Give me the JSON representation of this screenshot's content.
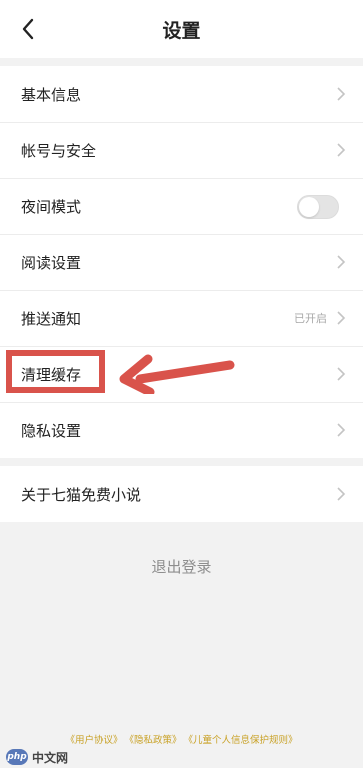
{
  "header": {
    "title": "设置"
  },
  "settings": {
    "items": [
      {
        "label": "基本信息"
      },
      {
        "label": "帐号与安全"
      },
      {
        "label": "夜间模式",
        "toggle": false
      },
      {
        "label": "阅读设置"
      },
      {
        "label": "推送通知",
        "value": "已开启"
      },
      {
        "label": "清理缓存"
      },
      {
        "label": "隐私设置"
      }
    ],
    "about": {
      "label": "关于七猫免费小说"
    }
  },
  "logout": {
    "label": "退出登录"
  },
  "footer": {
    "links": [
      "《用户协议》",
      "《隐私政策》",
      "《儿童个人信息保护规则》"
    ]
  },
  "watermark": {
    "logo": "php",
    "text": "中文网"
  },
  "colors": {
    "annotation": "#d9534b",
    "footer_link": "#c9a227",
    "background": "#f2f2f2"
  }
}
